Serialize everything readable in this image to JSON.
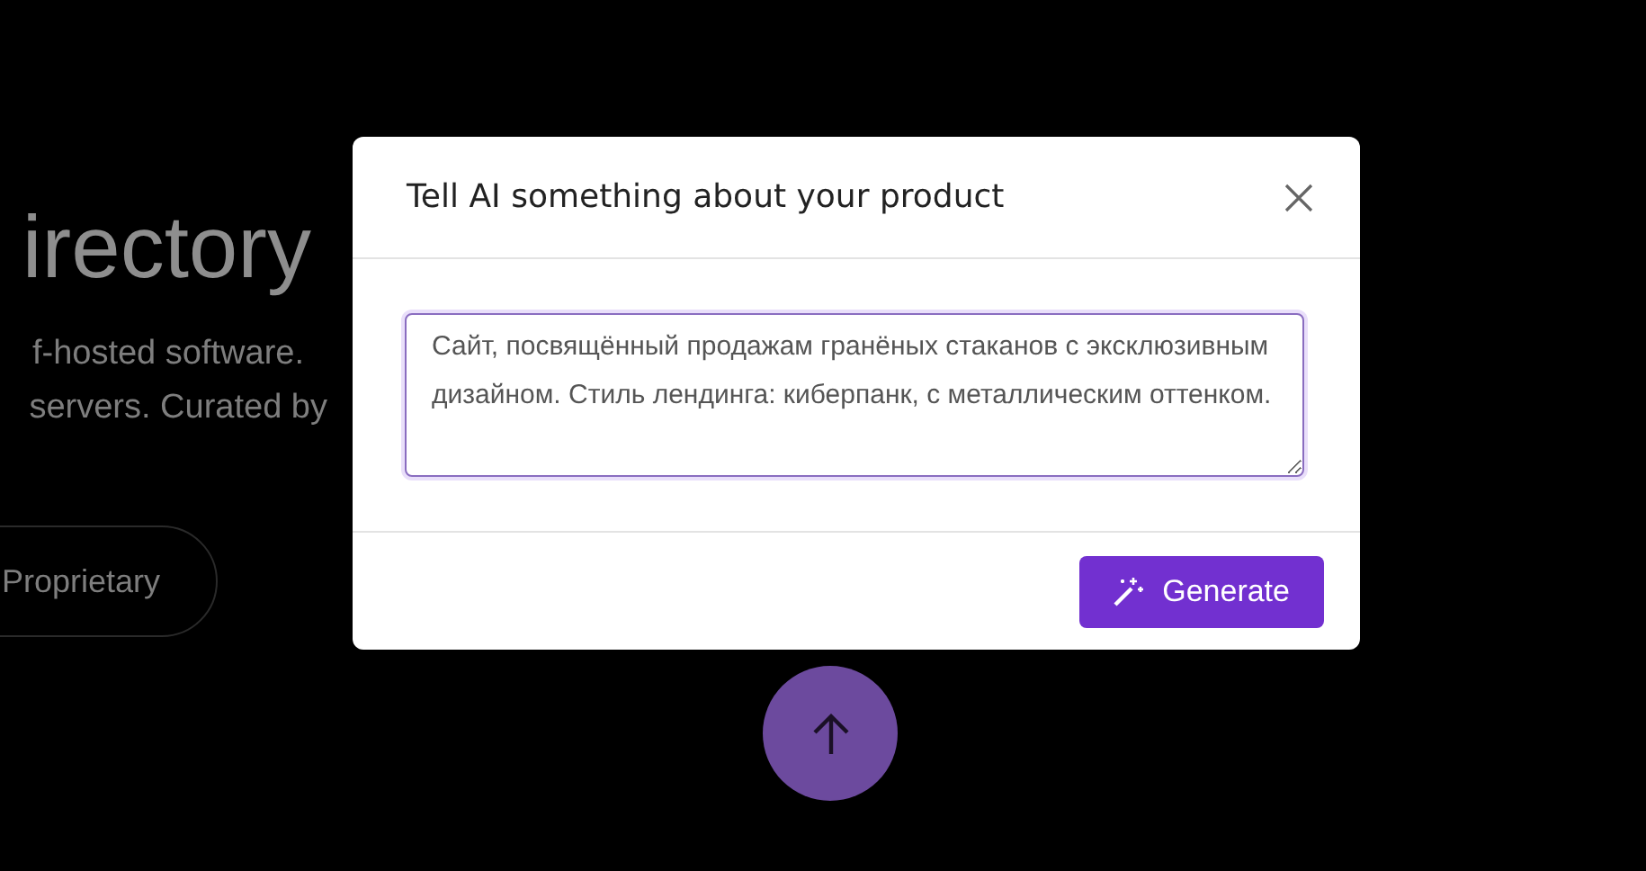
{
  "background": {
    "heading": "irectory",
    "description_lines": [
      "f-hosted software.",
      "servers. Curated by"
    ],
    "pill": "Proprietary"
  },
  "dialog": {
    "title": "Tell AI something about your product",
    "prompt": {
      "value": "Сайт, посвящённый продажам гранёных стаканов с эксклюзивным дизайном. Стиль лендинга: киберпанк, с металлическим оттенком."
    },
    "button": "Generate"
  }
}
